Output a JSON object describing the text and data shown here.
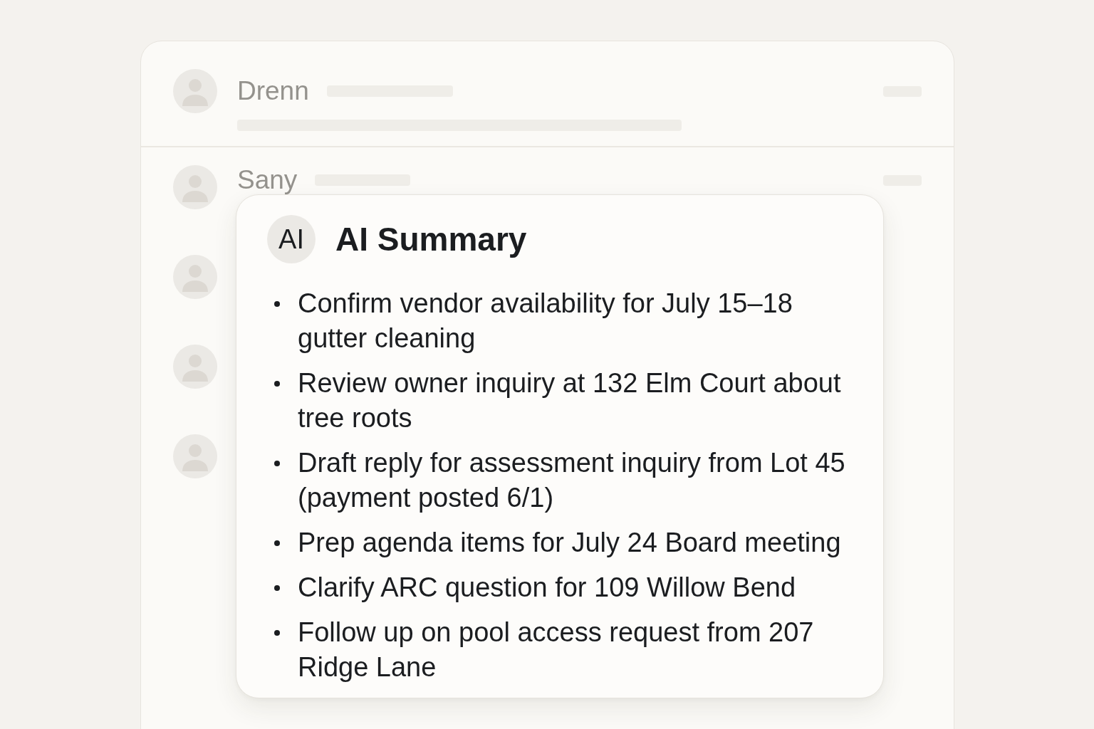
{
  "inbox": {
    "threads": [
      {
        "kind": "preview",
        "sender": "Drenn"
      },
      {
        "kind": "name",
        "sender": "Sany"
      },
      {
        "kind": "avatar"
      },
      {
        "kind": "avatar"
      },
      {
        "kind": "avatar"
      }
    ]
  },
  "summary": {
    "badge": "AI",
    "title": "AI Summary",
    "items": [
      "Confirm vendor availability for July 15–18 gutter cleaning",
      "Review owner inquiry at 132 Elm Court about tree roots",
      "Draft reply for assessment inquiry from Lot 45 (payment posted 6/1)",
      "Prep agenda items for July 24 Board meeting",
      "Clarify ARC question for 109 Willow Bend",
      "Follow up on pool access request from 207 Ridge Lane"
    ]
  }
}
